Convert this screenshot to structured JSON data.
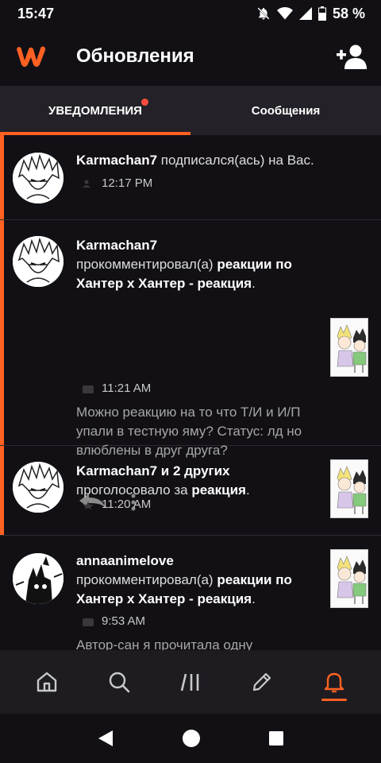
{
  "status_bar": {
    "time": "15:47",
    "battery": "58 %"
  },
  "header": {
    "title": "Обновления",
    "logo_icon": "wattpad-logo-icon",
    "add_user_icon": "add-user-icon"
  },
  "tabs": [
    {
      "label": "УВЕДОМЛЕНИЯ",
      "active": true,
      "has_dot": true
    },
    {
      "label": "Сообщения",
      "active": false,
      "has_dot": false
    }
  ],
  "notifications": [
    {
      "user": "Karmachan7",
      "action": "подписался(ась) на Вас.",
      "time": "12:17 PM"
    },
    {
      "user": "Karmachan7",
      "action": "прокомментировал(а)",
      "target": "реакции по Хантер х Хантер - реакция",
      "time": "11:21 AM",
      "comment": "Можно реакцию на то что Т/И и И/П упали в тестную яму? Статус: лд но влюблены в друг друга?"
    },
    {
      "user": "Karmachan7 и 2 других",
      "action": "проголосовало за",
      "target": "реакция",
      "time": "11:20 AM"
    },
    {
      "user": "annaanimelove",
      "action": "прокомментировал(а)",
      "target": "реакции по Хантер х Хантер - реакция",
      "time": "9:53 AM",
      "comment": "Автор-сан я прочитала одну"
    }
  ],
  "bottom_nav": [
    "home-icon",
    "search-icon",
    "library-icon",
    "write-icon",
    "notifications-bell-icon"
  ],
  "colors": {
    "accent": "#ff6122",
    "background": "#121015",
    "tab_bar": "#242228"
  }
}
